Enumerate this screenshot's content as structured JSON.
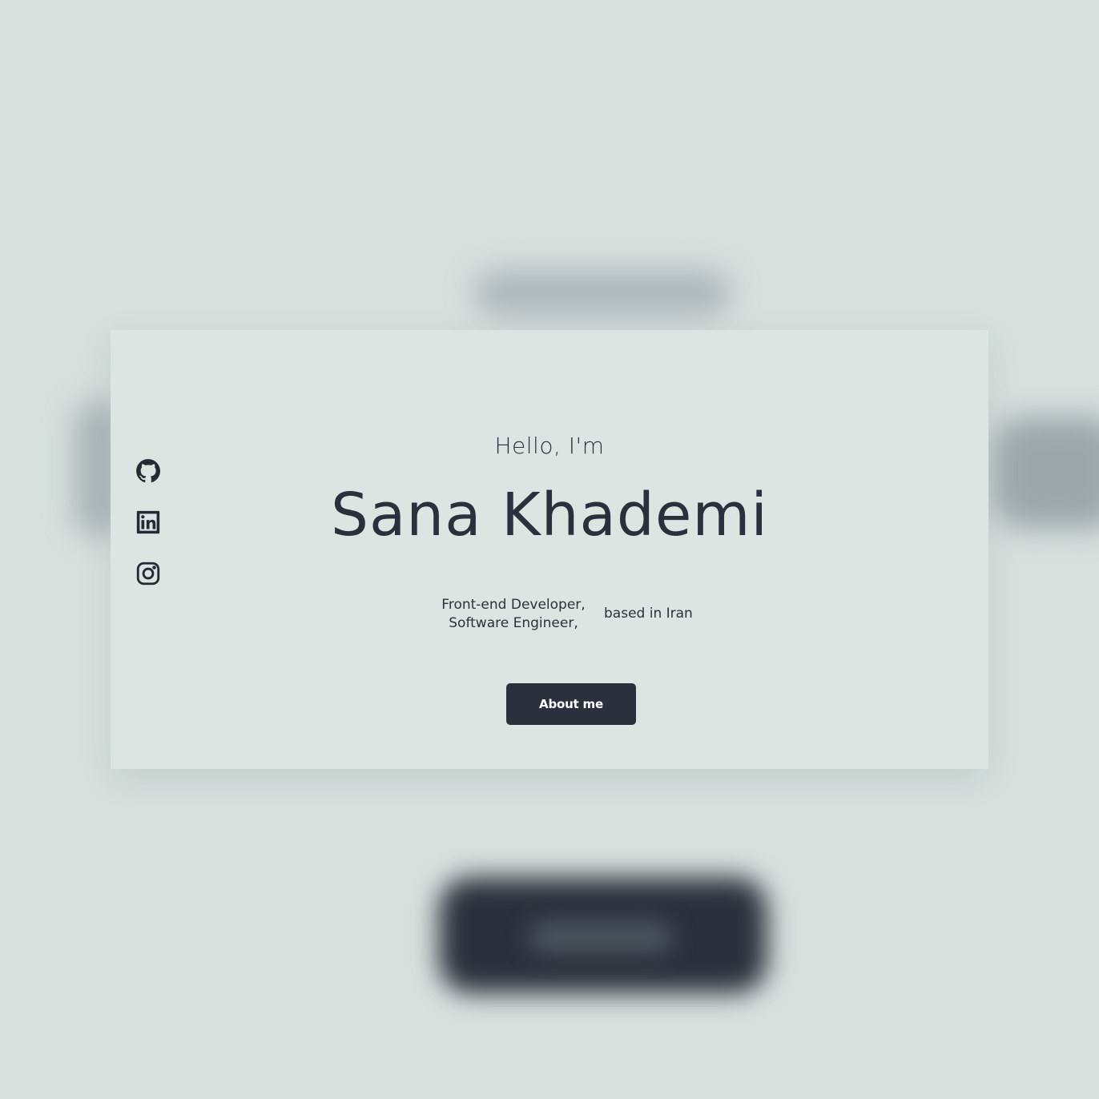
{
  "hero": {
    "greeting": "Hello, I'm",
    "name": "Sana Khademi",
    "roles": [
      "Front-end Developer,",
      "Software Engineer,"
    ],
    "location": "based in Iran",
    "cta_label": "About me"
  },
  "social": {
    "items": [
      {
        "name": "github",
        "icon": "github-icon"
      },
      {
        "name": "linkedin",
        "icon": "linkedin-icon"
      },
      {
        "name": "instagram",
        "icon": "instagram-icon"
      }
    ]
  },
  "colors": {
    "background": "#d7e0dd",
    "card": "#dde5e3",
    "text": "#2b313c",
    "button": "#2b313c",
    "button_text": "#ffffff"
  }
}
